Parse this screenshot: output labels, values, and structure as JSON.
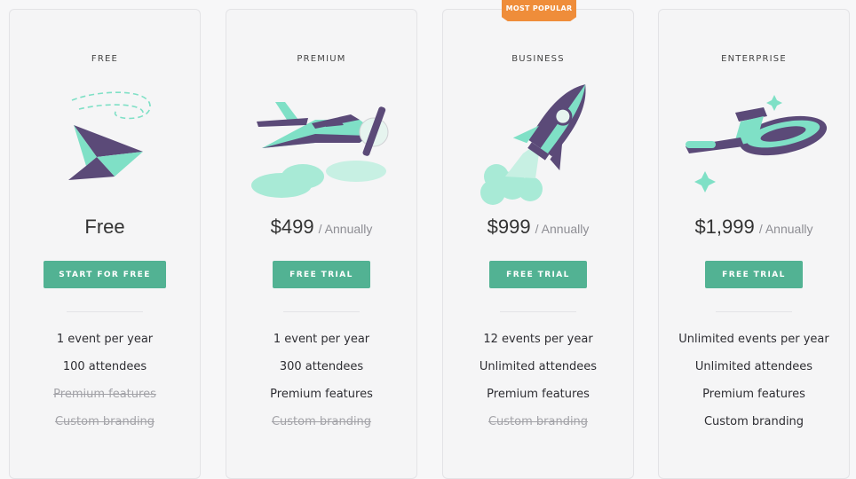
{
  "badge": {
    "label": "MOST POPULAR"
  },
  "colors": {
    "accent": "#52b293",
    "badge": "#ef8d3a",
    "illustration_teal": "#7fe0c6",
    "illustration_purple": "#5b4a78"
  },
  "plans": [
    {
      "name": "FREE",
      "illustration": "paper-plane-icon",
      "price": "Free",
      "period": "",
      "cta": "START FOR FREE",
      "features": [
        {
          "label": "1 event per year",
          "included": true
        },
        {
          "label": "100 attendees",
          "included": true
        },
        {
          "label": "Premium features",
          "included": false
        },
        {
          "label": "Custom branding",
          "included": false
        }
      ]
    },
    {
      "name": "PREMIUM",
      "illustration": "propeller-plane-icon",
      "price": "$499",
      "period": "/ Annually",
      "cta": "FREE TRIAL",
      "features": [
        {
          "label": "1 event per year",
          "included": true
        },
        {
          "label": "300 attendees",
          "included": true
        },
        {
          "label": "Premium features",
          "included": true
        },
        {
          "label": "Custom branding",
          "included": false
        }
      ]
    },
    {
      "name": "BUSINESS",
      "illustration": "rocket-icon",
      "price": "$999",
      "period": "/ Annually",
      "cta": "FREE TRIAL",
      "features": [
        {
          "label": "12 events per year",
          "included": true
        },
        {
          "label": "Unlimited attendees",
          "included": true
        },
        {
          "label": "Premium features",
          "included": true
        },
        {
          "label": "Custom branding",
          "included": false
        }
      ]
    },
    {
      "name": "ENTERPRISE",
      "illustration": "spaceship-icon",
      "price": "$1,999",
      "period": "/ Annually",
      "cta": "FREE TRIAL",
      "features": [
        {
          "label": "Unlimited events per year",
          "included": true
        },
        {
          "label": "Unlimited attendees",
          "included": true
        },
        {
          "label": "Premium features",
          "included": true
        },
        {
          "label": "Custom branding",
          "included": true
        }
      ]
    }
  ]
}
